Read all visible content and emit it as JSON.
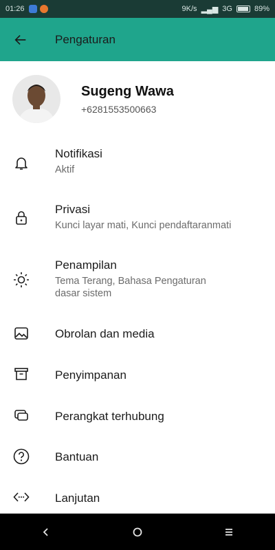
{
  "status_bar": {
    "time": "01:26",
    "network_speed": "9K/s",
    "network_type": "3G",
    "battery": "89%"
  },
  "app_bar": {
    "title": "Pengaturan",
    "back_icon": "arrow-left-icon"
  },
  "profile": {
    "name": "Sugeng Wawa",
    "phone": "+6281553500663"
  },
  "settings": [
    {
      "icon": "bell-icon",
      "title": "Notifikasi",
      "subtitle": "Aktif"
    },
    {
      "icon": "lock-icon",
      "title": "Privasi",
      "subtitle": "Kunci layar mati, Kunci pendaftaranmati"
    },
    {
      "icon": "sun-icon",
      "title": "Penampilan",
      "subtitle": "Tema Terang, Bahasa Pengaturan dasar sistem"
    },
    {
      "icon": "image-icon",
      "title": "Obrolan dan media",
      "subtitle": ""
    },
    {
      "icon": "archive-icon",
      "title": "Penyimpanan",
      "subtitle": ""
    },
    {
      "icon": "linked-devices-icon",
      "title": "Perangkat terhubung",
      "subtitle": ""
    },
    {
      "icon": "help-icon",
      "title": "Bantuan",
      "subtitle": ""
    },
    {
      "icon": "code-icon",
      "title": "Lanjutan",
      "subtitle": ""
    }
  ],
  "colors": {
    "app_bar": "#1fa58c",
    "status_bar": "#1a3b35",
    "nav_bar": "#000000"
  }
}
